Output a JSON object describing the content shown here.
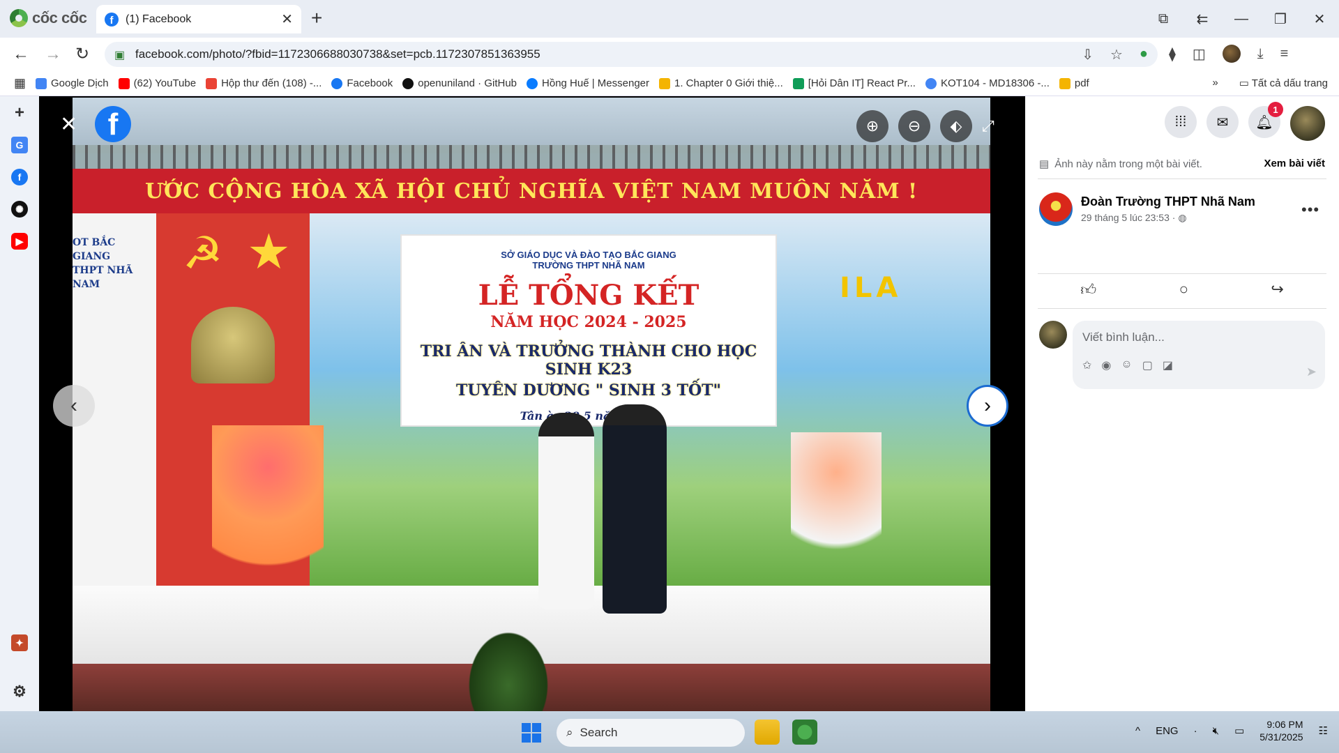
{
  "browser": {
    "brand": "cốc cốc",
    "tab_title": "(1) Facebook",
    "url": "facebook.com/photo/?fbid=1172306688030738&set=pcb.1172307851363955"
  },
  "bookmarks": [
    {
      "label": "Google Dịch",
      "color": "#4285f4"
    },
    {
      "label": "(62) YouTube",
      "color": "#ff0000"
    },
    {
      "label": "Hộp thư đến (108) -...",
      "color": "#ea4335"
    },
    {
      "label": "Facebook",
      "color": "#1877f2"
    },
    {
      "label": "openuniland · GitHub",
      "color": "#111111"
    },
    {
      "label": "Hồng Huế | Messenger",
      "color": "#0a7cff"
    },
    {
      "label": "1. Chapter 0 Giới thiệ...",
      "color": "#f4b400"
    },
    {
      "label": "[Hỏi Dân IT] React Pr...",
      "color": "#0f9d58"
    },
    {
      "label": "KOT104 - MD18306 -...",
      "color": "#4285f4"
    },
    {
      "label": "pdf",
      "color": "#f4b400"
    }
  ],
  "bookmarks_all": "Tất cả dấu trang",
  "photo": {
    "banner": "ƯỚC CỘNG HÒA XÃ HỘI CHỦ NGHĨA VIỆT NAM MUÔN NĂM !",
    "pillar_line1": "OT BẮC GIANG",
    "pillar_line2": "THPT NHÃ NAM",
    "board_line1": "SỞ GIÁO DỤC VÀ ĐÀO TẠO BẮC GIANG",
    "board_line2": "TRƯỜNG THPT NHÃ NAM",
    "board_title": "LỄ TỔNG KẾT",
    "board_year": "NĂM HỌC 2024 - 2025",
    "board_line5": "TRI ÂN VÀ TRƯỞNG THÀNH CHO HỌC SINH K23",
    "board_line6": "TUYÊN DƯƠNG \"  SINH 3 TỐT\"",
    "board_line7": "Tân        ày 29      5 năm 2025",
    "logo_text": "ILA"
  },
  "post": {
    "note": "Ảnh này nằm trong một bài viết.",
    "view_post": "Xem bài viết",
    "page_name": "Đoàn Trường THPT Nhã Nam",
    "time": "29 tháng 5 lúc 23:53",
    "comment_placeholder": "Viết bình luận...",
    "notifications": "1"
  },
  "taskbar": {
    "search": "Search",
    "lang": "ENG",
    "time": "9:06 PM",
    "date": "5/31/2025"
  }
}
